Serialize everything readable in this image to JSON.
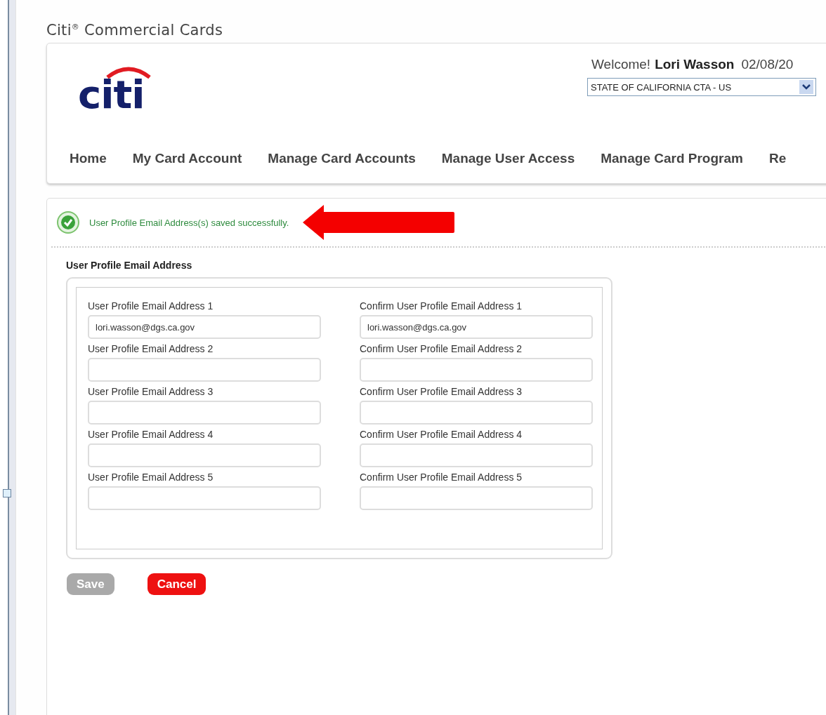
{
  "page_title": "Citi$^{®}$ Commercial Cards",
  "header": {
    "logo_text": "citi",
    "welcome": "Welcome!",
    "user_name": "Lori Wasson",
    "date": "02/08/20",
    "account_select": {
      "value": "STATE OF CALIFORNIA CTA - US"
    }
  },
  "nav": [
    "Home",
    "My Card Account",
    "Manage Card Accounts",
    "Manage User Access",
    "Manage Card Program",
    "Re"
  ],
  "message": {
    "kind": "success",
    "text": "User Profile Email Address(s) saved successfully."
  },
  "section_title": "User Profile Email Address",
  "fields": [
    {
      "label": "User Profile Email Address 1",
      "value": "lori.wasson@dgs.ca.gov",
      "confirm_label": "Confirm User Profile Email Address 1",
      "confirm_value": "lori.wasson@dgs.ca.gov"
    },
    {
      "label": "User Profile Email Address 2",
      "confirm_label": "Confirm User Profile Email Address 2"
    },
    {
      "label": "User Profile Email Address 3",
      "confirm_label": "Confirm User Profile Email Address 3"
    },
    {
      "label": "User Profile Email Address 4",
      "confirm_label": "Confirm User Profile Email Address 4"
    },
    {
      "label": "User Profile Email Address 5",
      "confirm_label": "Confirm User Profile Email Address 5"
    }
  ],
  "buttons": [
    {
      "label": "Save",
      "kind": "secondary",
      "disabled": true
    },
    {
      "label": "Cancel",
      "kind": "danger",
      "disabled": false
    }
  ]
}
